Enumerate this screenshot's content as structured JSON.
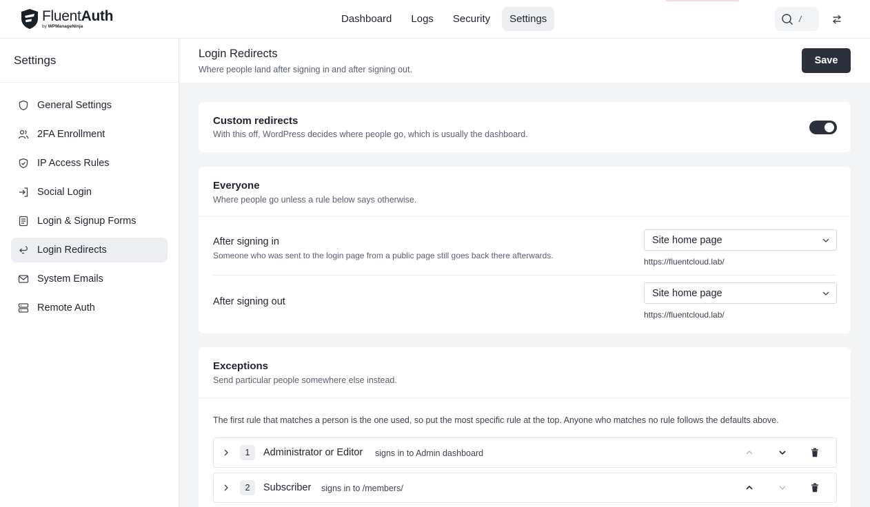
{
  "brand": {
    "name_light": "Fluent",
    "name_bold": "Auth",
    "byline_prefix": "by ",
    "byline_company": "WPManageNinja"
  },
  "nav": {
    "tabs": [
      "Dashboard",
      "Logs",
      "Security",
      "Settings"
    ],
    "active": "Settings"
  },
  "search": {
    "shortcut": "/"
  },
  "sidebar": {
    "title": "Settings",
    "items": [
      {
        "label": "General Settings",
        "icon": "shield-icon"
      },
      {
        "label": "2FA Enrollment",
        "icon": "users-icon"
      },
      {
        "label": "IP Access Rules",
        "icon": "shield-check-icon"
      },
      {
        "label": "Social Login",
        "icon": "login-arrow-icon"
      },
      {
        "label": "Login & Signup Forms",
        "icon": "form-icon"
      },
      {
        "label": "Login Redirects",
        "icon": "redirect-icon"
      },
      {
        "label": "System Emails",
        "icon": "mail-icon"
      },
      {
        "label": "Remote Auth",
        "icon": "server-icon"
      }
    ],
    "active": "Login Redirects"
  },
  "page": {
    "title": "Login Redirects",
    "subtitle": "Where people land after signing in and after signing out.",
    "save_label": "Save"
  },
  "custom": {
    "title": "Custom redirects",
    "subtitle": "With this off, WordPress decides where people go, which is usually the dashboard.",
    "enabled": true
  },
  "everyone": {
    "title": "Everyone",
    "subtitle": "Where people go unless a rule below says otherwise.",
    "signin": {
      "label": "After signing in",
      "help": "Someone who was sent to the login page from a public page still goes back there afterwards.",
      "value": "Site home page",
      "url": "https://fluentcloud.lab/"
    },
    "signout": {
      "label": "After signing out",
      "value": "Site home page",
      "url": "https://fluentcloud.lab/"
    }
  },
  "exceptions": {
    "title": "Exceptions",
    "subtitle": "Send particular people somewhere else instead.",
    "note": "The first rule that matches a person is the one used, so put the most specific rule at the top. Anyone who matches no rule follows the defaults above.",
    "rules": [
      {
        "num": "1",
        "role": "Administrator or Editor",
        "desc_prefix": "signs in to ",
        "target": "Admin dashboard"
      },
      {
        "num": "2",
        "role": "Subscriber",
        "desc_prefix": "signs in to ",
        "target": "/members/"
      }
    ]
  },
  "colors": {
    "dark": "#2b313c",
    "accent_top": "#f6d6d6",
    "active_bg": "#eceef1"
  }
}
